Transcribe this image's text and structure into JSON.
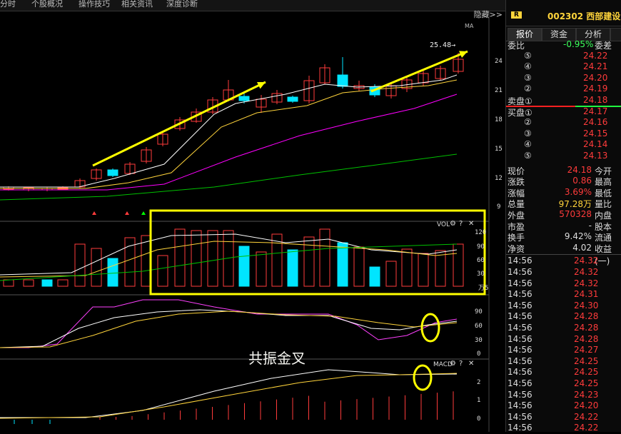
{
  "top_tabs": [
    "分时",
    "个股概况",
    "操作技巧",
    "相关资讯",
    "深度诊断"
  ],
  "hide_label": "隐藏>>",
  "ma_label": "MA",
  "price_marker": "25.48→",
  "price_axis": [
    "24",
    "21",
    "18",
    "15",
    "12",
    "9"
  ],
  "vol_panel": {
    "title": "VOL",
    "axis": [
      "120",
      "90",
      "60",
      "30"
    ],
    "unit": "万5"
  },
  "kdj_panel": {
    "axis": [
      "90",
      "60",
      "30",
      "0"
    ]
  },
  "macd_panel": {
    "title": "MACD",
    "axis": [
      "2",
      "1",
      "0"
    ]
  },
  "annotation": "共振金叉",
  "stock": {
    "badge": "R",
    "code_name": "002302 西部建设"
  },
  "tabs": [
    "报价",
    "资金",
    "分析"
  ],
  "quote": {
    "weibi_label": "委比",
    "weibi_value": "-0.95%",
    "weicha_label": "委差",
    "sells": [
      {
        "label": "⑤",
        "price": "24.22"
      },
      {
        "label": "④",
        "price": "24.21"
      },
      {
        "label": "③",
        "price": "24.20"
      },
      {
        "label": "②",
        "price": "24.19"
      },
      {
        "label": "卖盘①",
        "price": "24.18"
      }
    ],
    "buys": [
      {
        "label": "买盘①",
        "price": "24.17"
      },
      {
        "label": "②",
        "price": "24.16"
      },
      {
        "label": "③",
        "price": "24.15"
      },
      {
        "label": "④",
        "price": "24.14"
      },
      {
        "label": "⑤",
        "price": "24.13"
      }
    ],
    "stats": [
      {
        "l": "现价",
        "v": "24.18",
        "r": "今开",
        "c": "red"
      },
      {
        "l": "涨跌",
        "v": "0.86",
        "r": "最高",
        "c": "red"
      },
      {
        "l": "涨幅",
        "v": "3.69%",
        "r": "最低",
        "c": "red"
      },
      {
        "l": "总量",
        "v": "97.28万",
        "r": "量比",
        "c": "yellow"
      },
      {
        "l": "外盘",
        "v": "570328",
        "r": "内盘",
        "c": "red"
      },
      {
        "l": "市盈",
        "v": "-",
        "r": "股本",
        "c": "white"
      },
      {
        "l": "换手",
        "v": "9.42%",
        "r": "流通",
        "c": "white"
      },
      {
        "l": "净资",
        "v": "4.02",
        "r": "收益(一)",
        "c": "white"
      }
    ],
    "ticks": [
      {
        "t": "14:56",
        "p": "24.32"
      },
      {
        "t": "14:56",
        "p": "24.32"
      },
      {
        "t": "14:56",
        "p": "24.32"
      },
      {
        "t": "14:56",
        "p": "24.31"
      },
      {
        "t": "14:56",
        "p": "24.30"
      },
      {
        "t": "14:56",
        "p": "24.28"
      },
      {
        "t": "14:56",
        "p": "24.28"
      },
      {
        "t": "14:56",
        "p": "24.28"
      },
      {
        "t": "14:56",
        "p": "24.27"
      },
      {
        "t": "14:56",
        "p": "24.25"
      },
      {
        "t": "14:56",
        "p": "24.25"
      },
      {
        "t": "14:56",
        "p": "24.25"
      },
      {
        "t": "14:56",
        "p": "24.23"
      },
      {
        "t": "14:56",
        "p": "24.20"
      },
      {
        "t": "14:56",
        "p": "24.22"
      },
      {
        "t": "14:56",
        "p": "24.22"
      }
    ]
  },
  "colors": {
    "up": "#ff3b3b",
    "down": "#00e5ff",
    "ma5": "#ffffff",
    "ma10": "#ffd43b",
    "ma20": "#ff00ff",
    "ma60": "#00c000",
    "highlight": "#ffff00"
  }
}
